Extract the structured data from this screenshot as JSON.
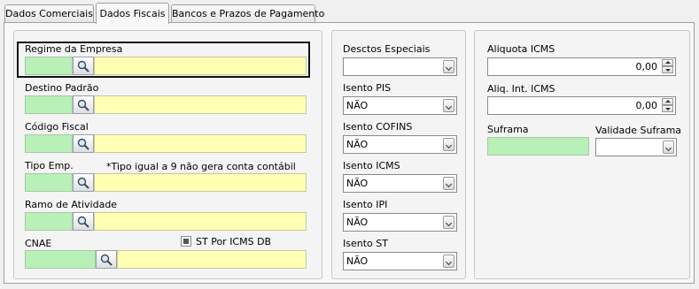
{
  "tabs": [
    {
      "label": "Dados Comerciais",
      "active": false
    },
    {
      "label": "Dados Fiscais",
      "active": true
    },
    {
      "label": "Bancos e Prazos de Pagamento",
      "active": false
    }
  ],
  "left": {
    "regime": {
      "label": "Regime da Empresa",
      "code": "",
      "description": ""
    },
    "destino": {
      "label": "Destino Padrão",
      "code": "",
      "description": ""
    },
    "codigo_fiscal": {
      "label": "Código Fiscal",
      "code": "",
      "description": ""
    },
    "tipo_emp": {
      "label": "Tipo Emp.",
      "note": "*Tipo igual a 9 não gera conta contábil",
      "code": "",
      "description": ""
    },
    "ramo": {
      "label": "Ramo de Atividade",
      "code": "",
      "description": ""
    },
    "cnae": {
      "label": "CNAE",
      "code": "",
      "description": "",
      "st_label": "ST Por ICMS DB",
      "st_checked": true
    }
  },
  "middle": {
    "desctos": {
      "label": "Desctos Especiais",
      "value": ""
    },
    "pis": {
      "label": "Isento PIS",
      "value": "NÃO"
    },
    "cofins": {
      "label": "Isento COFINS",
      "value": "NÃO"
    },
    "icms": {
      "label": "Isento ICMS",
      "value": "NÃO"
    },
    "ipi": {
      "label": "Isento IPI",
      "value": "NÃO"
    },
    "st": {
      "label": "Isento ST",
      "value": "NÃO"
    }
  },
  "right": {
    "aliquota": {
      "label": "Aliquota ICMS",
      "value": "0,00"
    },
    "aliq_int": {
      "label": "Aliq. Int. ICMS",
      "value": "0,00"
    },
    "suframa": {
      "label": "Suframa",
      "value": ""
    },
    "validade": {
      "label": "Validade Suframa",
      "value": ""
    }
  },
  "colors": {
    "code_field": "#b8f0b8",
    "desc_field": "#ffffb4",
    "panel": "#f4f4f4"
  }
}
